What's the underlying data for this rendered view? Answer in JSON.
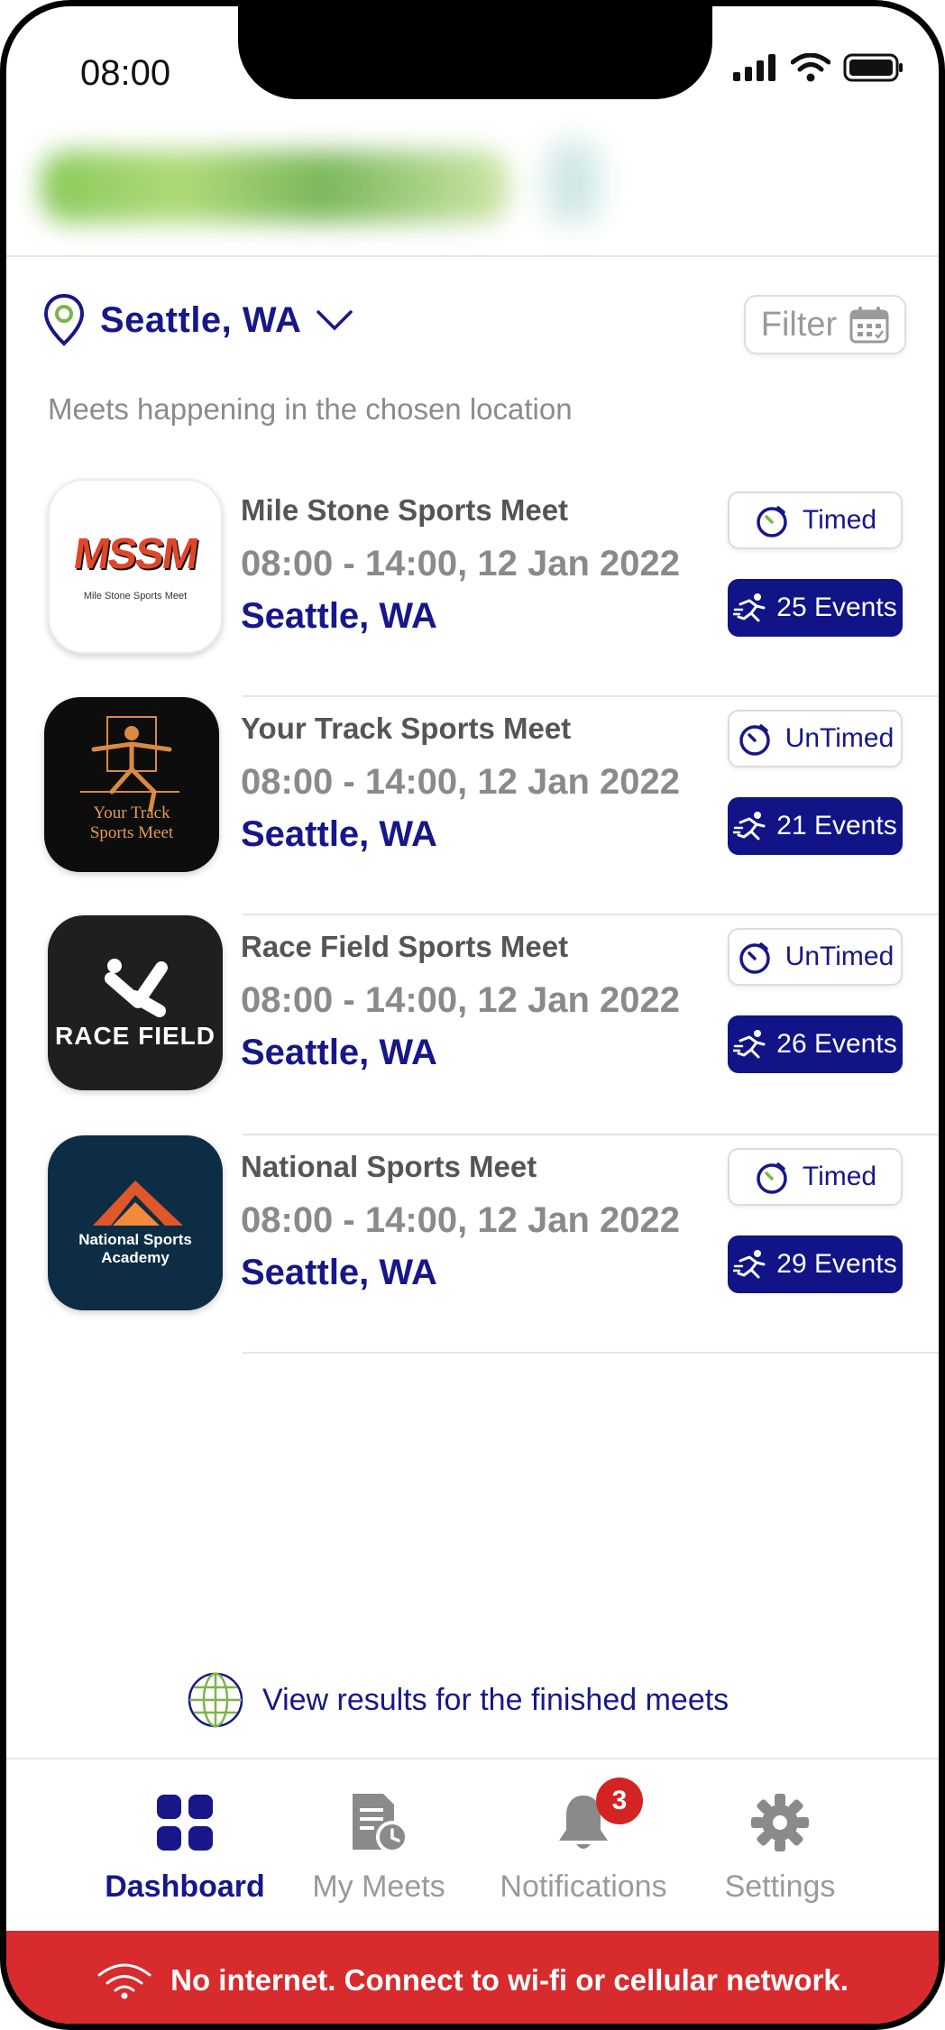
{
  "status": {
    "time": "08:00"
  },
  "location": {
    "city": "Seattle, WA"
  },
  "filter": {
    "label": "Filter"
  },
  "subtitle": "Meets happening in the chosen location",
  "meets": [
    {
      "name": "Mile Stone Sports Meet",
      "time": "08:00 - 14:00, 12 Jan 2022",
      "city": "Seattle, WA",
      "tag": "Timed",
      "events": "25 Events",
      "logo_text": "MSSM",
      "logo_sub": "Mile Stone Sports Meet"
    },
    {
      "name": "Your Track Sports Meet",
      "time": "08:00 - 14:00, 12 Jan 2022",
      "city": "Seattle, WA",
      "tag": "UnTimed",
      "events": "21 Events",
      "logo_text": "Your Track",
      "logo_sub": "Sports Meet"
    },
    {
      "name": "Race Field Sports Meet",
      "time": "08:00 - 14:00, 12 Jan 2022",
      "city": "Seattle, WA",
      "tag": "UnTimed",
      "events": "26 Events",
      "logo_text": "RACE FIELD"
    },
    {
      "name": "National Sports Meet",
      "time": "08:00 - 14:00, 12 Jan 2022",
      "city": "Seattle, WA",
      "tag": "Timed",
      "events": "29 Events",
      "logo_text": "National Sports",
      "logo_sub": "Academy"
    }
  ],
  "results_link": "View results for the finished meets",
  "tabs": [
    {
      "label": "Dashboard",
      "icon": "dashboard-grid-icon"
    },
    {
      "label": "My Meets",
      "icon": "document-clock-icon"
    },
    {
      "label": "Notifications",
      "icon": "bell-icon",
      "badge": "3"
    },
    {
      "label": "Settings",
      "icon": "gear-icon"
    }
  ],
  "offline_banner": "No internet. Connect to wi-fi or cellular network.",
  "colors": {
    "primary": "#17178a",
    "events_bg": "#101487",
    "accent_green": "#7ab648",
    "alert": "#d72b2e"
  }
}
